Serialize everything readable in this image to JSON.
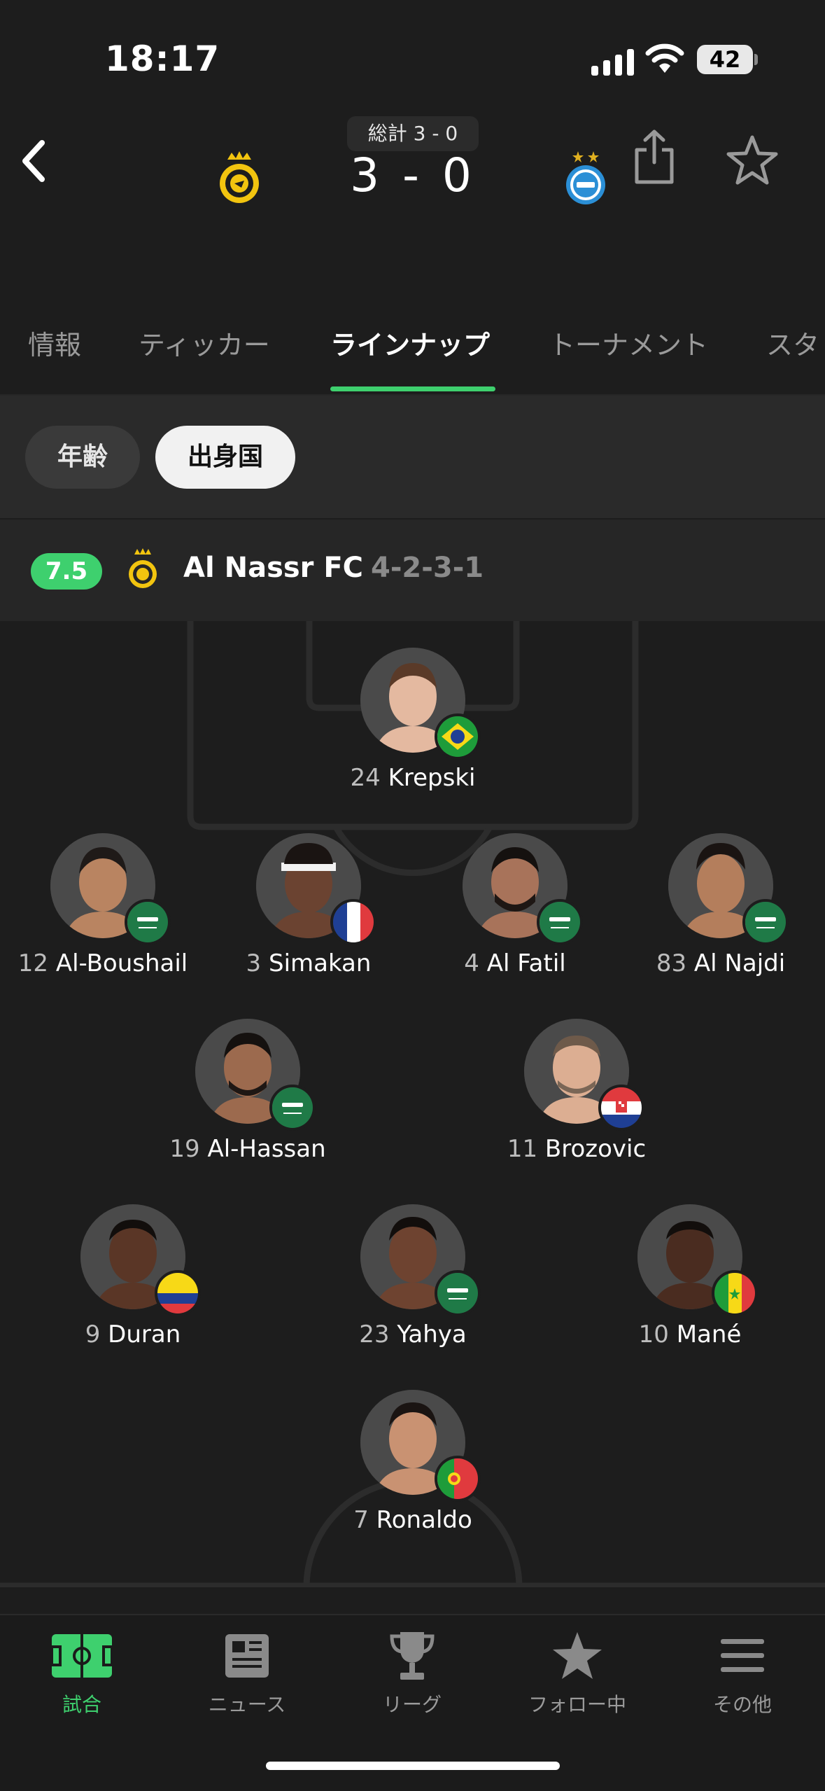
{
  "status_bar": {
    "time": "18:17",
    "battery": "42"
  },
  "match": {
    "aggregate": "総計 3 - 0",
    "score": "3 - 0",
    "home_team_logo": "al-nassr-crest",
    "away_team_logo": "esteghlal-crest"
  },
  "tabs": [
    {
      "label": "情報",
      "active": false
    },
    {
      "label": "ティッカー",
      "active": false
    },
    {
      "label": "ラインナップ",
      "active": true
    },
    {
      "label": "トーナメント",
      "active": false
    },
    {
      "label": "スタ",
      "active": false
    }
  ],
  "filters": {
    "age": "年齢",
    "country": "出身国",
    "selected": "出身国"
  },
  "team": {
    "rating": "7.5",
    "name": "Al Nassr FC",
    "formation": "4-2-3-1"
  },
  "players": [
    {
      "number": "24",
      "name": "Krepski",
      "flag": "brazil"
    },
    {
      "number": "12",
      "name": "Al-Boushail",
      "flag": "saudi-arabia"
    },
    {
      "number": "3",
      "name": "Simakan",
      "flag": "france"
    },
    {
      "number": "4",
      "name": "Al Fatil",
      "flag": "saudi-arabia"
    },
    {
      "number": "83",
      "name": "Al Najdi",
      "flag": "saudi-arabia"
    },
    {
      "number": "19",
      "name": "Al-Hassan",
      "flag": "saudi-arabia"
    },
    {
      "number": "11",
      "name": "Brozovic",
      "flag": "croatia"
    },
    {
      "number": "9",
      "name": "Duran",
      "flag": "colombia"
    },
    {
      "number": "23",
      "name": "Yahya",
      "flag": "saudi-arabia"
    },
    {
      "number": "10",
      "name": "Mané",
      "flag": "senegal"
    },
    {
      "number": "7",
      "name": "Ronaldo",
      "flag": "portugal"
    }
  ],
  "nav": [
    {
      "label": "試合",
      "icon": "pitch-icon",
      "active": true
    },
    {
      "label": "ニュース",
      "icon": "news-icon",
      "active": false
    },
    {
      "label": "リーグ",
      "icon": "trophy-icon",
      "active": false
    },
    {
      "label": "フォロー中",
      "icon": "star-icon",
      "active": false
    },
    {
      "label": "その他",
      "icon": "menu-icon",
      "active": false
    }
  ],
  "colors": {
    "accent": "#3ed06e",
    "background": "#1d1d1d",
    "home": "#f2c40f",
    "away": "#2b8fd6"
  }
}
